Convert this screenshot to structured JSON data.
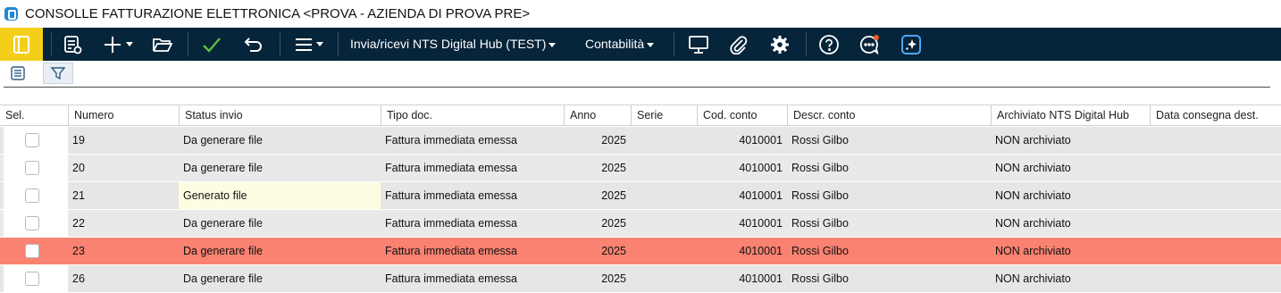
{
  "window": {
    "title": "CONSOLLE FATTURAZIONE ELETTRONICA <PROVA - AZIENDA DI PROVA PRE>"
  },
  "toolbar": {
    "menu_nts": "Invia/ricevi NTS Digital Hub (TEST)",
    "menu_contabilita": "Contabilità",
    "icons": [
      "panel-toggle-icon",
      "report-icon",
      "add-icon",
      "folder-open-icon",
      "confirm-check-icon",
      "undo-icon",
      "hamburger-menu-icon",
      "monitor-icon",
      "paperclip-icon",
      "settings-gear-icon",
      "help-icon",
      "chat-notification-icon",
      "ai-assistant-icon"
    ],
    "accent_color": "#f4cf1a",
    "background_color": "#06243a"
  },
  "subbar": {
    "icons": [
      "list-view-icon",
      "filter-icon"
    ]
  },
  "grid": {
    "columns": [
      "Sel.",
      "Numero",
      "Status invio",
      "Tipo doc.",
      "Anno",
      "Serie",
      "Cod. conto",
      "Descr. conto",
      "Archiviato NTS Digital Hub",
      "Data consegna dest."
    ],
    "selected_row_color": "#f98271",
    "rows": [
      {
        "numero": "19",
        "status": "Da generare file",
        "tipo": "Fattura immediata emessa",
        "anno": "2025",
        "serie": "",
        "cod_conto": "4010001",
        "descr_conto": "Rossi Gilbo",
        "archiviato": "NON archiviato",
        "data_consegna": ""
      },
      {
        "numero": "20",
        "status": "Da generare file",
        "tipo": "Fattura immediata emessa",
        "anno": "2025",
        "serie": "",
        "cod_conto": "4010001",
        "descr_conto": "Rossi Gilbo",
        "archiviato": "NON archiviato",
        "data_consegna": ""
      },
      {
        "numero": "21",
        "status": "Generato file",
        "tipo": "Fattura immediata emessa",
        "anno": "2025",
        "serie": "",
        "cod_conto": "4010001",
        "descr_conto": "Rossi Gilbo",
        "archiviato": "NON archiviato",
        "data_consegna": ""
      },
      {
        "numero": "22",
        "status": "Da generare file",
        "tipo": "Fattura immediata emessa",
        "anno": "2025",
        "serie": "",
        "cod_conto": "4010001",
        "descr_conto": "Rossi Gilbo",
        "archiviato": "NON archiviato",
        "data_consegna": ""
      },
      {
        "numero": "23",
        "status": "Da generare file",
        "tipo": "Fattura immediata emessa",
        "anno": "2025",
        "serie": "",
        "cod_conto": "4010001",
        "descr_conto": "Rossi Gilbo",
        "archiviato": "NON archiviato",
        "data_consegna": ""
      },
      {
        "numero": "26",
        "status": "Da generare file",
        "tipo": "Fattura immediata emessa",
        "anno": "2025",
        "serie": "",
        "cod_conto": "4010001",
        "descr_conto": "Rossi Gilbo",
        "archiviato": "NON archiviato",
        "data_consegna": ""
      }
    ]
  }
}
